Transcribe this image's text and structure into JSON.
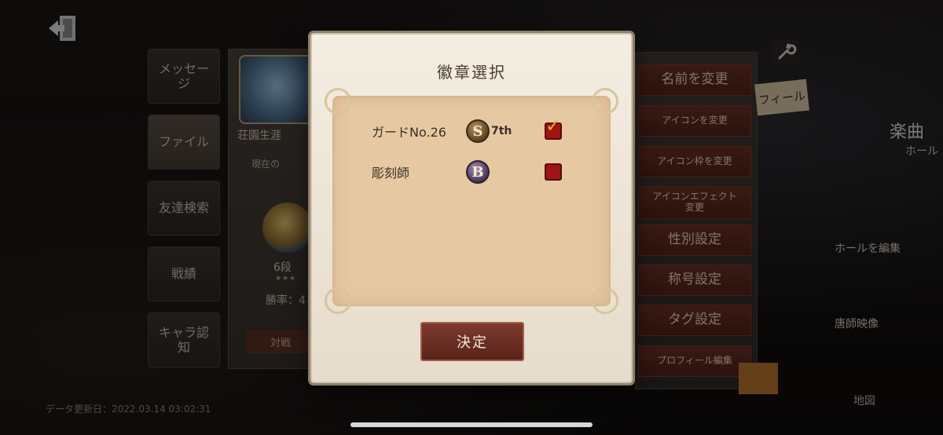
{
  "modal": {
    "title": "徽章選択",
    "badges": [
      {
        "name": "ガードNo.26",
        "icon_letter": "S",
        "tier": "7th",
        "checked": true
      },
      {
        "name": "彫刻師",
        "icon_letter": "B",
        "tier": "",
        "checked": false
      }
    ],
    "confirm_label": "決定"
  },
  "left_tabs": [
    "メッセージ",
    "ファイル",
    "友達検索",
    "戦績",
    "キャラ認知"
  ],
  "profile": {
    "name": "荘園生涯",
    "current_label": "現在の",
    "rank": "6段",
    "rank_stars": "★★★",
    "win_rate": "勝率：4",
    "battle_label": "対戦"
  },
  "actions": [
    "名前を変更",
    "アイコンを変更",
    "アイコン枠を変更",
    "アイコンエフェクト\n変更",
    "性別設定",
    "称号設定",
    "タグ設定",
    "プロフィール編集"
  ],
  "right_side": {
    "profile_tab": "フィール",
    "name": "楽曲",
    "sub": "ホール",
    "edit_label": "ホールを編集",
    "video_label": "唐師映像",
    "map_label": "地図"
  },
  "timestamp": "データ更新日：2022.03.14 03:02:31",
  "icons": {
    "exit": "exit-door-icon",
    "wrench": "wrench-icon",
    "badge_s": "s-badge-icon",
    "badge_b": "b-badge-icon",
    "checkbox": "red-checkbox-icon"
  },
  "colors": {
    "accent_red": "#7c3a2c",
    "parchment": "#e6c9a3",
    "modal_bg": "#f3ede2"
  }
}
